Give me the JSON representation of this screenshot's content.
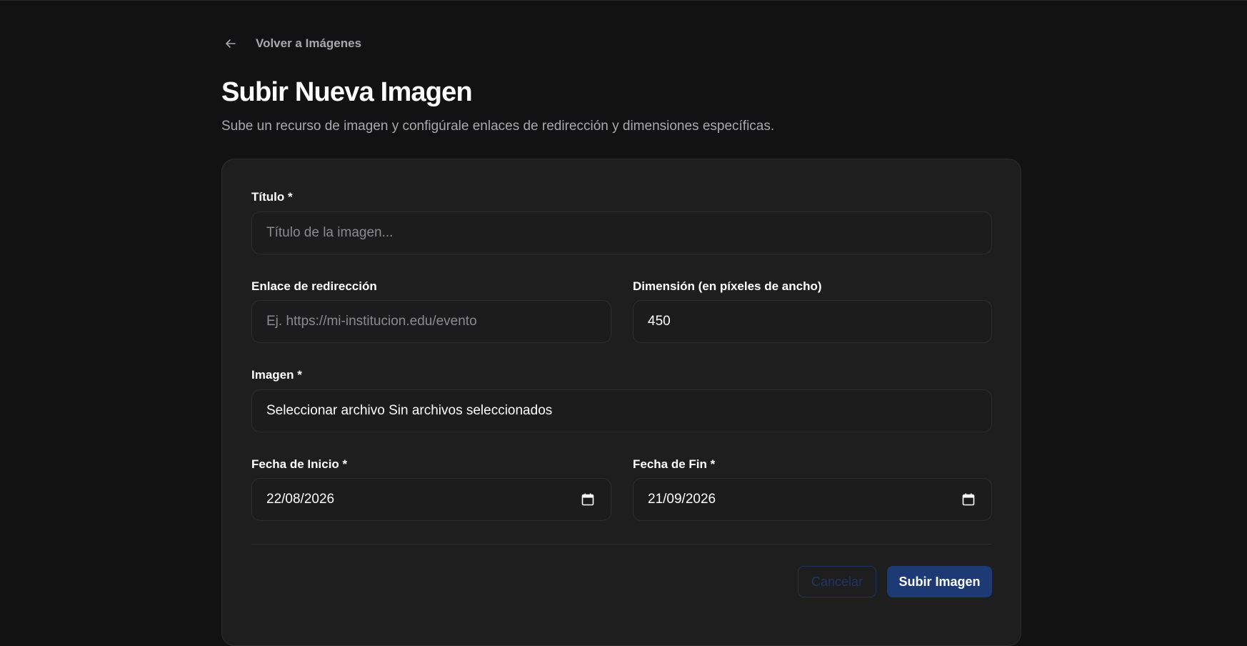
{
  "nav": {
    "back_label": "Volver a Imágenes"
  },
  "header": {
    "title": "Subir Nueva Imagen",
    "subtitle": "Sube un recurso de imagen y configúrale enlaces de redirección y dimensiones específicas."
  },
  "form": {
    "title_field": {
      "label": "Título *",
      "placeholder": "Título de la imagen..."
    },
    "link_field": {
      "label": "Enlace de redirección",
      "placeholder": "Ej. https://mi-institucion.edu/evento"
    },
    "dimension_field": {
      "label": "Dimensión (en píxeles de ancho)",
      "value": "450"
    },
    "image_field": {
      "label": "Imagen *",
      "value": "Seleccionar archivo Sin archivos seleccionados"
    },
    "start_date_field": {
      "label": "Fecha de Inicio *",
      "value": "22/08/2026",
      "icon": "calendar-icon"
    },
    "end_date_field": {
      "label": "Fecha de Fin *",
      "value": "21/09/2026",
      "icon": "calendar-icon"
    }
  },
  "actions": {
    "cancel_label": "Cancelar",
    "submit_label": "Subir Imagen"
  },
  "colors": {
    "background": "#121212",
    "card": "#1e1e1e",
    "accent": "#1e3a75"
  }
}
